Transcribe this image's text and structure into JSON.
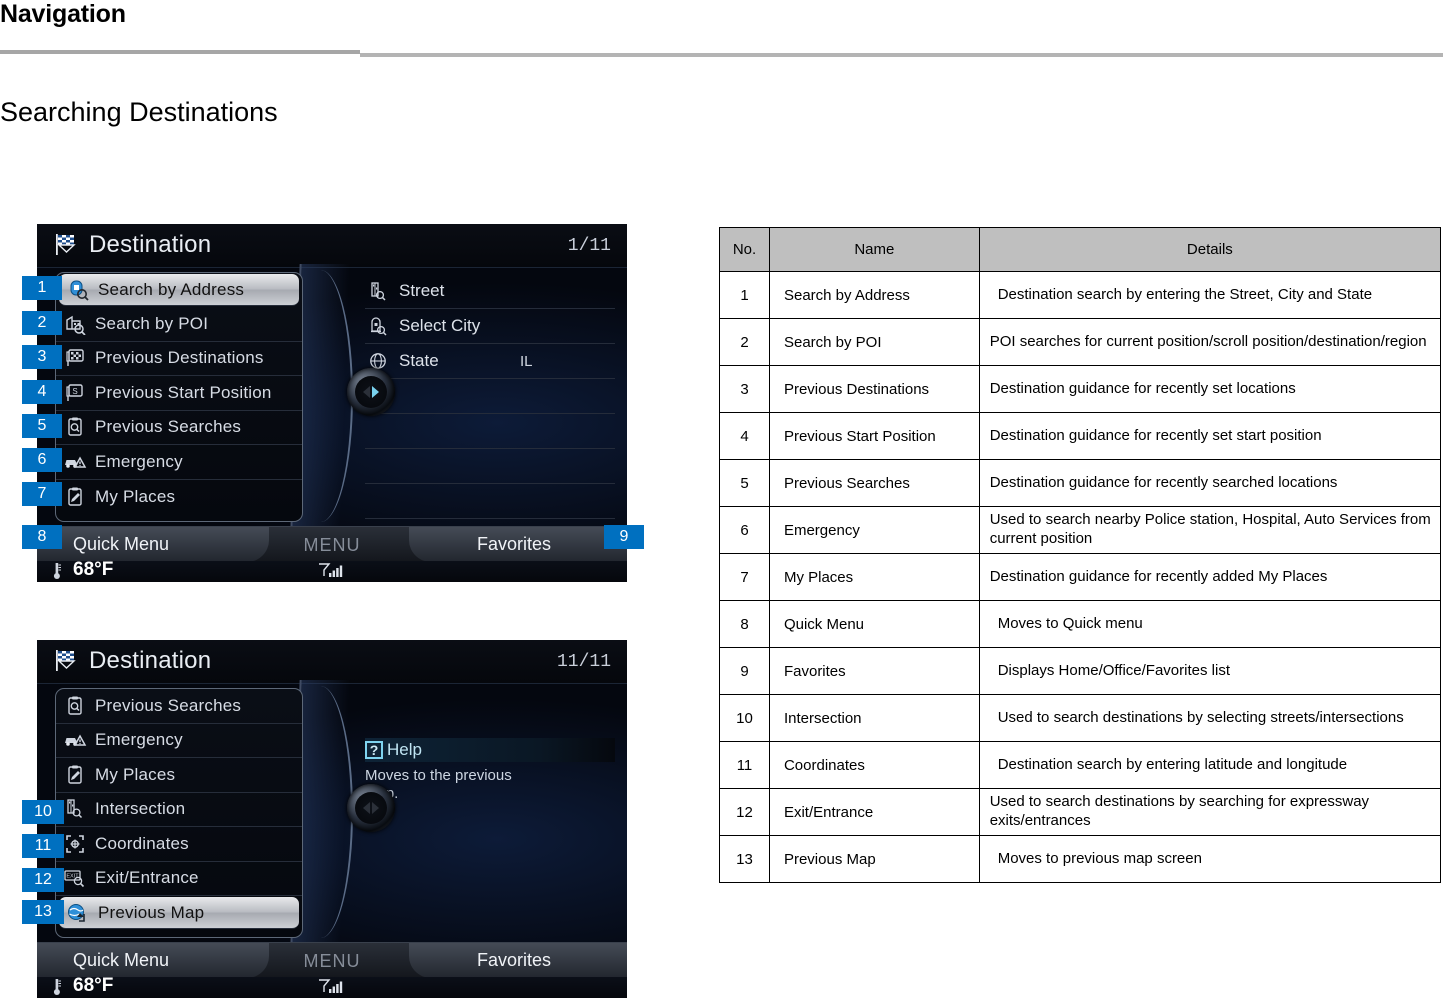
{
  "header": {
    "title": "Navigation",
    "section_title": "Searching Destinations"
  },
  "screens": [
    {
      "id": "screen-one",
      "title": "Destination",
      "page_count": "1/11",
      "title_icon": "checkered-flag-icon",
      "list": [
        {
          "label": "Search by Address",
          "icon": "address-search-icon",
          "selected": true
        },
        {
          "label": "Search by POI",
          "icon": "poi-search-icon",
          "selected": false
        },
        {
          "label": "Previous Destinations",
          "icon": "previous-destinations-icon",
          "selected": false
        },
        {
          "label": "Previous Start Position",
          "icon": "previous-start-position-icon",
          "selected": false
        },
        {
          "label": "Previous Searches",
          "icon": "previous-searches-icon",
          "selected": false
        },
        {
          "label": "Emergency",
          "icon": "emergency-car-icon",
          "selected": false
        },
        {
          "label": "My Places",
          "icon": "my-places-icon",
          "selected": false
        }
      ],
      "right_rows": [
        {
          "label": "Street",
          "icon": "street-search-icon",
          "value": ""
        },
        {
          "label": "Select City",
          "icon": "city-search-icon",
          "value": ""
        },
        {
          "label": "State",
          "icon": "globe-icon",
          "value": "IL"
        }
      ],
      "tabs": {
        "left": "Quick Menu",
        "center": "MENU",
        "right": "Favorites"
      },
      "status": {
        "temperature": "68°F",
        "thermometer_icon": "thermometer-icon",
        "signal_icon": "signal-bars-icon"
      }
    },
    {
      "id": "screen-two",
      "title": "Destination",
      "page_count": "11/11",
      "title_icon": "checkered-flag-icon",
      "list": [
        {
          "label": "Previous Searches",
          "icon": "previous-searches-icon",
          "selected": false
        },
        {
          "label": "Emergency",
          "icon": "emergency-car-icon",
          "selected": false
        },
        {
          "label": "My Places",
          "icon": "my-places-icon",
          "selected": false
        },
        {
          "label": "Intersection",
          "icon": "intersection-icon",
          "selected": false
        },
        {
          "label": "Coordinates",
          "icon": "coordinates-icon",
          "selected": false
        },
        {
          "label": "Exit/Entrance",
          "icon": "exit-entrance-icon",
          "selected": false
        },
        {
          "label": "Previous Map",
          "icon": "previous-map-icon",
          "selected": true
        }
      ],
      "help": {
        "badge": "?",
        "title": "Help",
        "text": "Moves to the previous map."
      },
      "tabs": {
        "left": "Quick Menu",
        "center": "MENU",
        "right": "Favorites"
      },
      "status": {
        "temperature": "68°F",
        "thermometer_icon": "thermometer-icon",
        "signal_icon": "signal-bars-icon"
      }
    }
  ],
  "badges": {
    "screen_one": [
      "1",
      "2",
      "3",
      "4",
      "5",
      "6",
      "7",
      "8",
      "9"
    ],
    "screen_two": [
      "10",
      "11",
      "12",
      "13"
    ]
  },
  "table": {
    "columns": [
      "No.",
      "Name",
      "Details"
    ],
    "rows": [
      {
        "no": "1",
        "name": "Search by Address",
        "details": "Destination search by entering the Street, City and State",
        "indent": true
      },
      {
        "no": "2",
        "name": "Search by POI",
        "details": "POI searches for current position/scroll position/destination/region",
        "indent": false
      },
      {
        "no": "3",
        "name": "Previous Destinations",
        "details": "Destination guidance for recently set locations",
        "indent": false
      },
      {
        "no": "4",
        "name": "Previous Start Position",
        "details": "Destination guidance for recently set start position",
        "indent": false
      },
      {
        "no": "5",
        "name": "Previous Searches",
        "details": "Destination guidance for recently searched locations",
        "indent": false
      },
      {
        "no": "6",
        "name": "Emergency",
        "details": "Used to search nearby Police station, Hospital, Auto Services from current position",
        "indent": false
      },
      {
        "no": "7",
        "name": "My Places",
        "details": "Destination guidance for recently added My Places",
        "indent": false
      },
      {
        "no": "8",
        "name": "Quick Menu",
        "details": "Moves to Quick menu",
        "indent": true
      },
      {
        "no": "9",
        "name": "Favorites",
        "details": "Displays Home/Office/Favorites list",
        "indent": true
      },
      {
        "no": "10",
        "name": "Intersection",
        "details": "Used to search destinations by selecting streets/intersections",
        "indent": true
      },
      {
        "no": "11",
        "name": "Coordinates",
        "details": "Destination search by entering latitude and longitude",
        "indent": true
      },
      {
        "no": "12",
        "name": "Exit/Entrance",
        "details": "Used to search destinations by searching for expressway exits/entrances",
        "indent": false
      },
      {
        "no": "13",
        "name": "Previous Map",
        "details": "Moves to previous map screen",
        "indent": true
      }
    ]
  },
  "colors": {
    "badge_blue": "#0070C0",
    "table_header_gray": "#BFBFBF",
    "rule_gray": "#A6A6A6"
  }
}
